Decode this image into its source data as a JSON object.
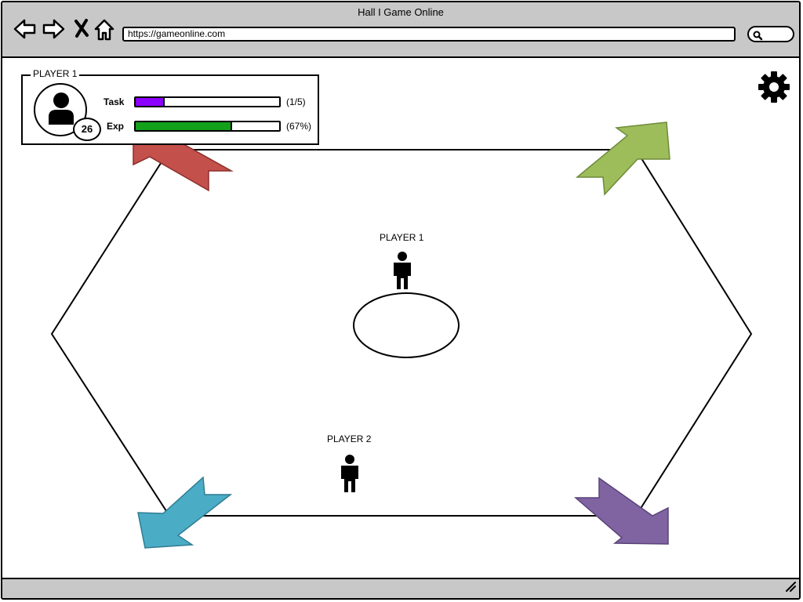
{
  "window": {
    "title": "Hall I Game Online",
    "url": "https://gameonline.com"
  },
  "hud": {
    "player_name": "PLAYER 1",
    "level": "26",
    "task": {
      "label": "Task",
      "value_text": "(1/5)",
      "fraction": 0.2,
      "color": "#8b00ff"
    },
    "exp": {
      "label": "Exp",
      "value_text": "(67%)",
      "fraction": 0.67,
      "color": "#13a01b"
    }
  },
  "board": {
    "arrows": [
      {
        "name": "red-arrow",
        "color": "#c4504b",
        "direction": "up-left"
      },
      {
        "name": "green-arrow",
        "color": "#9dbd5a",
        "direction": "up-right"
      },
      {
        "name": "blue-arrow",
        "color": "#4bacc6",
        "direction": "down-left"
      },
      {
        "name": "purple-arrow",
        "color": "#8064a2",
        "direction": "down-right"
      }
    ],
    "players": [
      {
        "label": "PLAYER 1"
      },
      {
        "label": "PLAYER 2"
      }
    ]
  },
  "icons": {
    "back": "back-arrow-icon",
    "forward": "forward-arrow-icon",
    "stop": "close-icon",
    "home": "home-icon",
    "search": "search-icon",
    "settings": "gear-icon",
    "avatar": "user-icon",
    "player": "person-icon"
  }
}
